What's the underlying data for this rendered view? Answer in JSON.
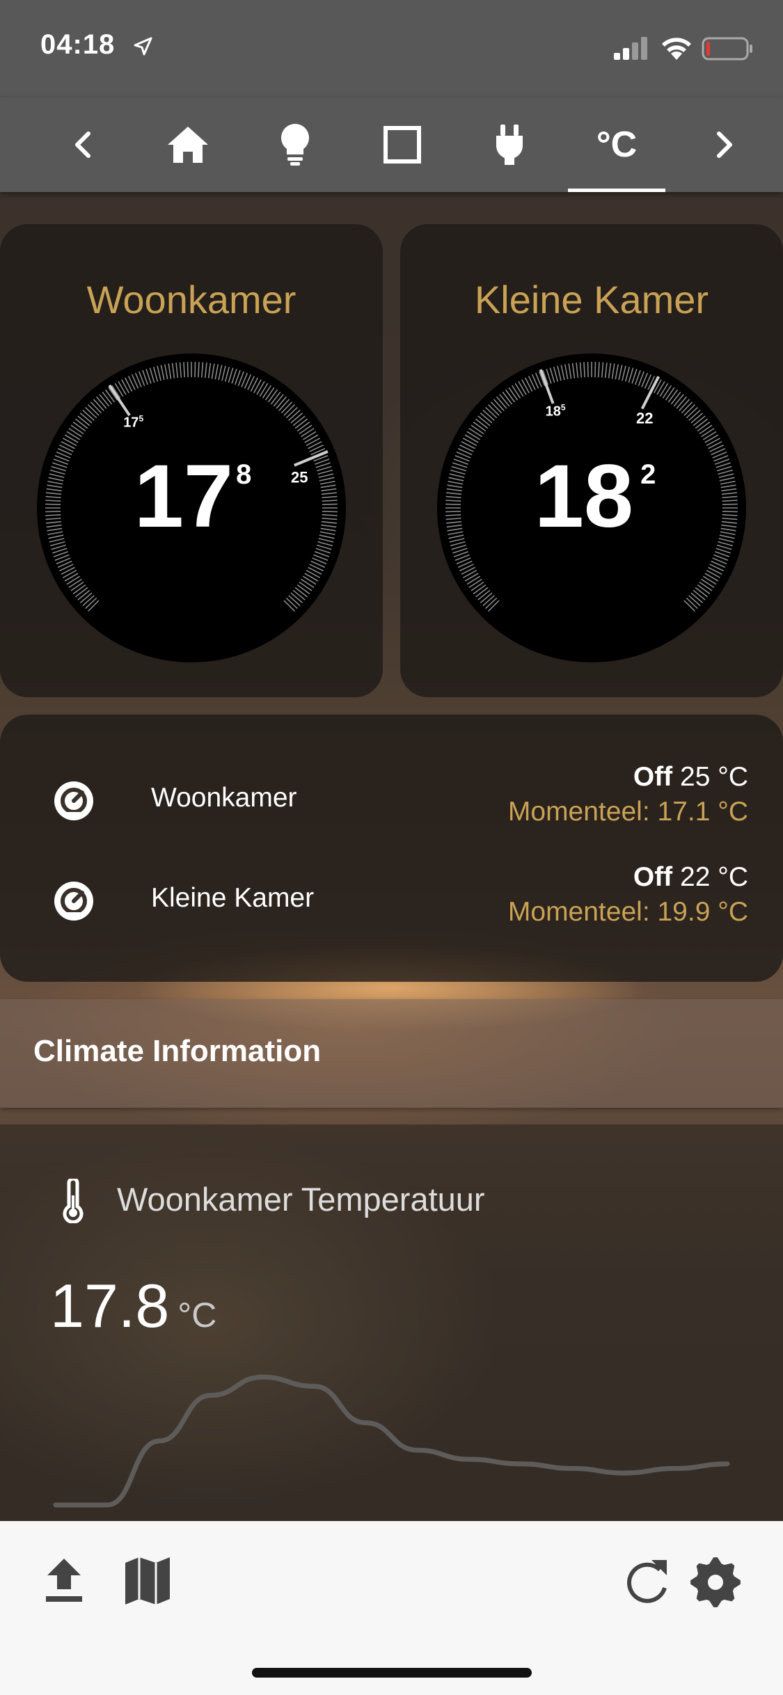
{
  "status_bar": {
    "time": "04:18"
  },
  "toolbar": {
    "items": [
      {
        "name": "back",
        "icon": "chevron-left-icon"
      },
      {
        "name": "home",
        "icon": "home-icon"
      },
      {
        "name": "lights",
        "icon": "lightbulb-icon"
      },
      {
        "name": "covers",
        "icon": "square-icon"
      },
      {
        "name": "switches",
        "icon": "plug-icon"
      },
      {
        "name": "climate",
        "label": "°C",
        "active": true
      },
      {
        "name": "forward",
        "icon": "chevron-right-icon"
      }
    ]
  },
  "thermostats": [
    {
      "title": "Woonkamer",
      "current_int": "17",
      "current_dec": "8",
      "target_label_int": "17",
      "target_label_dec": "5",
      "setpoint_label": "25",
      "current_value": 17.8,
      "target_value": 17.5,
      "setpoint_value": 25
    },
    {
      "title": "Kleine Kamer",
      "current_int": "18",
      "current_dec": "2",
      "target_label_int": "18",
      "target_label_dec": "5",
      "setpoint_label": "22",
      "current_value": 18.2,
      "target_value": 18.5,
      "setpoint_value": 22
    }
  ],
  "entities": [
    {
      "name": "Woonkamer",
      "state": "Off",
      "setpoint": "25 °C",
      "current": "Momenteel: 17.1 °C",
      "icon": "thermostat-icon"
    },
    {
      "name": "Kleine Kamer",
      "state": "Off",
      "setpoint": "22 °C",
      "current": "Momenteel: 19.9 °C",
      "icon": "thermostat-icon"
    }
  ],
  "climate_section": {
    "title": "Climate Information"
  },
  "sensor": {
    "title": "Woonkamer Temperatuur",
    "value": "17.8",
    "unit": "°C",
    "icon": "thermometer-icon",
    "sparkline": [
      17.2,
      17.2,
      17.9,
      18.4,
      18.6,
      18.5,
      18.1,
      17.8,
      17.7,
      17.65,
      17.6,
      17.55,
      17.6,
      17.65
    ]
  },
  "bottom_bar": {
    "left_icons": [
      "upload-icon",
      "map-icon"
    ],
    "right_icons": [
      "refresh-icon",
      "gear-icon"
    ]
  },
  "colors": {
    "accent": "#c9a255",
    "toolbar": "#585858",
    "card": "#1e1a17"
  }
}
